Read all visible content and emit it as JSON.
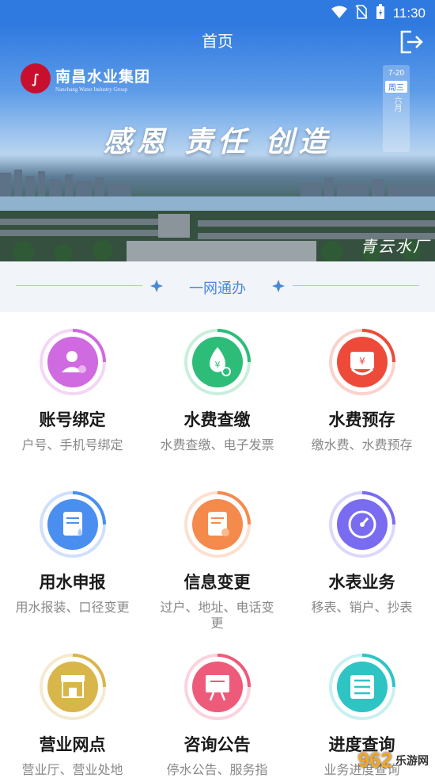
{
  "status_bar": {
    "time": "11:30"
  },
  "header": {
    "title": "首页"
  },
  "banner": {
    "logo_text": "南昌水业集团",
    "logo_subtext": "Nanchang Water Industry Group",
    "slogan": "感恩 责任 创造",
    "calendar_date": "7-20",
    "calendar_weekday": "周三",
    "calendar_lunar": "六月",
    "place_label": "青云水厂"
  },
  "section": {
    "title": "一网通办"
  },
  "services": [
    {
      "name": "账号绑定",
      "desc": "户号、手机号绑定",
      "icon": "user-bind-icon",
      "color": "#d06ae0"
    },
    {
      "name": "水费查缴",
      "desc": "水费查缴、电子发票",
      "icon": "water-drop-search-icon",
      "color": "#2dbd79"
    },
    {
      "name": "水费预存",
      "desc": "缴水费、水费预存",
      "icon": "yen-deposit-icon",
      "color": "#ee4a3a"
    },
    {
      "name": "用水申报",
      "desc": "用水报装、口径变更",
      "icon": "document-drop-icon",
      "color": "#4a8ff0"
    },
    {
      "name": "信息变更",
      "desc": "过户、地址、电话变更",
      "icon": "document-edit-icon",
      "color": "#f58a4d"
    },
    {
      "name": "水表业务",
      "desc": "移表、销户、抄表",
      "icon": "meter-gauge-icon",
      "color": "#7a6cf0"
    },
    {
      "name": "营业网点",
      "desc": "营业厅、营业处地",
      "icon": "store-location-icon",
      "color": "#d9b64a"
    },
    {
      "name": "咨询公告",
      "desc": "停水公告、服务指",
      "icon": "notice-board-icon",
      "color": "#ee5a7a"
    },
    {
      "name": "进度查询",
      "desc": "业务进度查询",
      "icon": "list-progress-icon",
      "color": "#2ec4c4"
    }
  ],
  "watermark": {
    "big": "962",
    "small": "乐游网"
  }
}
